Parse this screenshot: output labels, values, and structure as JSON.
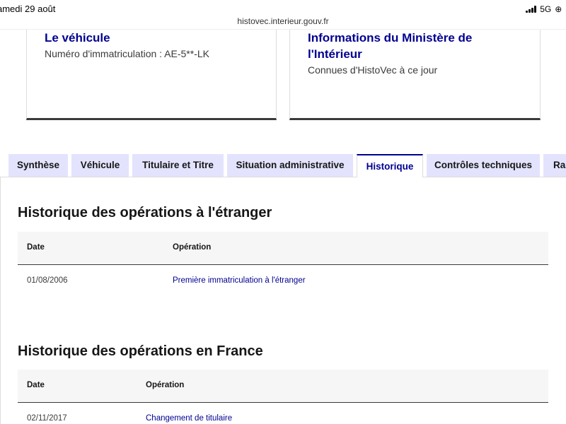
{
  "status": {
    "time": "amedi 29 août",
    "network": "5G",
    "battery": "8"
  },
  "browser": {
    "url": "histovec.interieur.gouv.fr"
  },
  "cards": [
    {
      "title": "Le véhicule",
      "description": "Numéro d'immatriculation : AE-5**-LK"
    },
    {
      "title": "Informations du Ministère de l'Intérieur",
      "description": "Connues d'HistoVec à ce jour"
    }
  ],
  "tabs": [
    {
      "label": "Synthèse",
      "active": false
    },
    {
      "label": "Véhicule",
      "active": false
    },
    {
      "label": "Titulaire et Titre",
      "active": false
    },
    {
      "label": "Situation administrative",
      "active": false
    },
    {
      "label": "Historique",
      "active": true
    },
    {
      "label": "Contrôles techniques",
      "active": false
    },
    {
      "label": "Rap",
      "active": false
    }
  ],
  "sections": [
    {
      "title": "Historique des opérations à l'étranger",
      "columns": [
        "Date",
        "Opération"
      ],
      "rows": [
        {
          "date": "01/08/2006",
          "operation": "Première immatriculation à l'étranger"
        }
      ]
    },
    {
      "title": "Historique des opérations en France",
      "columns": [
        "Date",
        "Opération"
      ],
      "rows": [
        {
          "date": "02/11/2017",
          "operation": "Changement de titulaire"
        }
      ]
    }
  ],
  "colors": {
    "accent": "#000091",
    "tab_bg": "#e3e3fd",
    "text": "#161616"
  }
}
